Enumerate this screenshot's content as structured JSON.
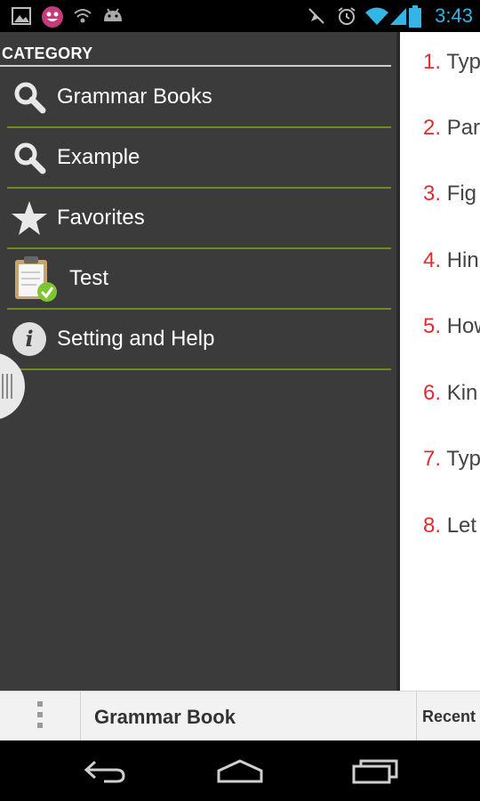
{
  "status_bar": {
    "time": "3:43",
    "left_icons": [
      "gallery-icon",
      "face-app-icon",
      "wifi-signal-icon",
      "android-icon"
    ],
    "right_icons": [
      "mute-icon",
      "alarm-icon",
      "wifi-icon",
      "cell-signal-icon",
      "battery-icon"
    ],
    "accent_color": "#33b5e5"
  },
  "drawer": {
    "header": "CATEGORY",
    "items": [
      {
        "label": "Grammar Books",
        "icon": "search-icon"
      },
      {
        "label": "Example",
        "icon": "search-icon"
      },
      {
        "label": "Favorites",
        "icon": "star-icon"
      },
      {
        "label": "Test",
        "icon": "clipboard-check-icon"
      },
      {
        "label": "Setting and Help",
        "icon": "info-icon"
      }
    ],
    "separator_color": "#6d8a2a",
    "background_color": "#3b3b3b"
  },
  "content": {
    "items": [
      {
        "num": "1.",
        "text": "Typ"
      },
      {
        "num": "2.",
        "text": "Par"
      },
      {
        "num": "3.",
        "text": "Fig"
      },
      {
        "num": "4.",
        "text": "Hin"
      },
      {
        "num": "5.",
        "text": "How"
      },
      {
        "num": "6.",
        "text": "Kin"
      },
      {
        "num": "7.",
        "text": "Typ"
      },
      {
        "num": "8.",
        "text": "Let"
      }
    ],
    "number_color": "#e52b2b"
  },
  "action_bar": {
    "title": "Grammar Book",
    "recent_label": "Recent",
    "overflow_icon": "overflow-menu-icon"
  },
  "nav_bar": {
    "buttons": [
      "back-icon",
      "home-icon",
      "recent-apps-icon"
    ]
  }
}
